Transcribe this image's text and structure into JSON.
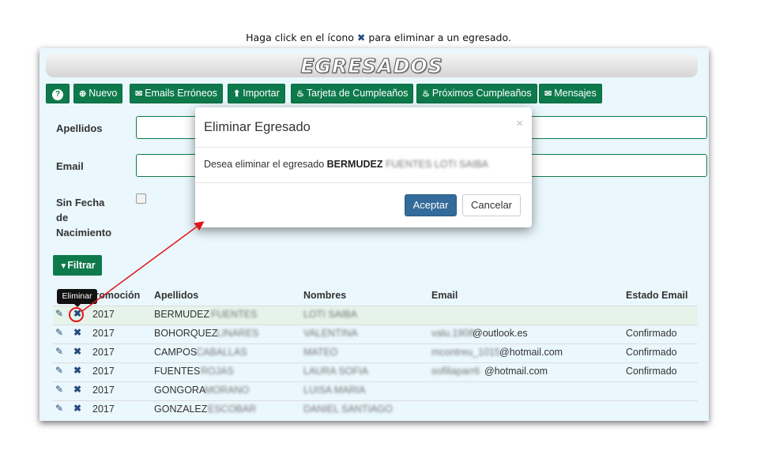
{
  "instruction": {
    "before": "Haga click en el ícono",
    "icon": "close-icon",
    "after": "para eliminar a un egresado."
  },
  "page_title": "EGRESADOS",
  "toolbar": {
    "help_label": "?",
    "nuevo_label": "Nuevo",
    "emails_erroneos_label": "Emails Erróneos",
    "importar_label": "Importar",
    "tarjeta_label": "Tarjeta de Cumpleaños",
    "proximos_label": "Próximos Cumpleaños",
    "mensajes_label": "Mensajes"
  },
  "filters": {
    "apellidos_label": "Apellidos",
    "email_label": "Email",
    "sin_fecha_label_1": "Sin Fecha",
    "sin_fecha_label_2": "de",
    "sin_fecha_label_3": "Nacimiento",
    "filtrar_label": "Filtrar"
  },
  "tooltip": "Eliminar",
  "table": {
    "headers": {
      "promocion": "Promoción",
      "apellidos": "Apellidos",
      "nombres": "Nombres",
      "email": "Email",
      "estado": "Estado Email"
    },
    "rows": [
      {
        "promocion": "2017",
        "apellido": "BERMUDEZ",
        "apellido_blur": "FUENTES",
        "nombres_blur": "LOTI SAIBA",
        "email_blur": "",
        "email_domain": "",
        "estado": ""
      },
      {
        "promocion": "2017",
        "apellido": "BOHORQUEZ",
        "apellido_blur": "LINARES",
        "nombres_blur": "VALENTINA",
        "email_blur": "valu.1908",
        "email_domain": "@outlook.es",
        "estado": "Confirmado"
      },
      {
        "promocion": "2017",
        "apellido": "CAMPOS",
        "apellido_blur": "CABALLAS",
        "nombres_blur": "MATEO",
        "email_blur": "mcontreu_1015",
        "email_domain": "@hotmail.com",
        "estado": "Confirmado"
      },
      {
        "promocion": "2017",
        "apellido": "FUENTES",
        "apellido_blur": "ROJAS",
        "nombres_blur": "LAURA SOFIA",
        "email_blur": "sofiliaparr6",
        "email_domain": "@hotmail.com",
        "estado": "Confirmado"
      },
      {
        "promocion": "2017",
        "apellido": "GONGORA",
        "apellido_blur": "MORANO",
        "nombres_blur": "LUISA MARIA",
        "email_blur": "",
        "email_domain": "",
        "estado": ""
      },
      {
        "promocion": "2017",
        "apellido": "GONZALEZ",
        "apellido_blur": "ESCOBAR",
        "nombres_blur": "DANIEL SANTIAGO",
        "email_blur": "",
        "email_domain": "",
        "estado": ""
      }
    ]
  },
  "modal": {
    "title": "Eliminar Egresado",
    "close": "×",
    "text_prefix": "Desea eliminar el egresado",
    "name_bold": "BERMUDEZ",
    "name_blur": "FUENTES LOTI SAIBA",
    "accept_label": "Aceptar",
    "cancel_label": "Cancelar"
  },
  "colors": {
    "primary_green": "#0e7a4c",
    "panel_bg": "#eaf7fd",
    "icon_blue": "#244b7a",
    "accept_blue": "#336b9a",
    "annotation_red": "#e0151c"
  }
}
